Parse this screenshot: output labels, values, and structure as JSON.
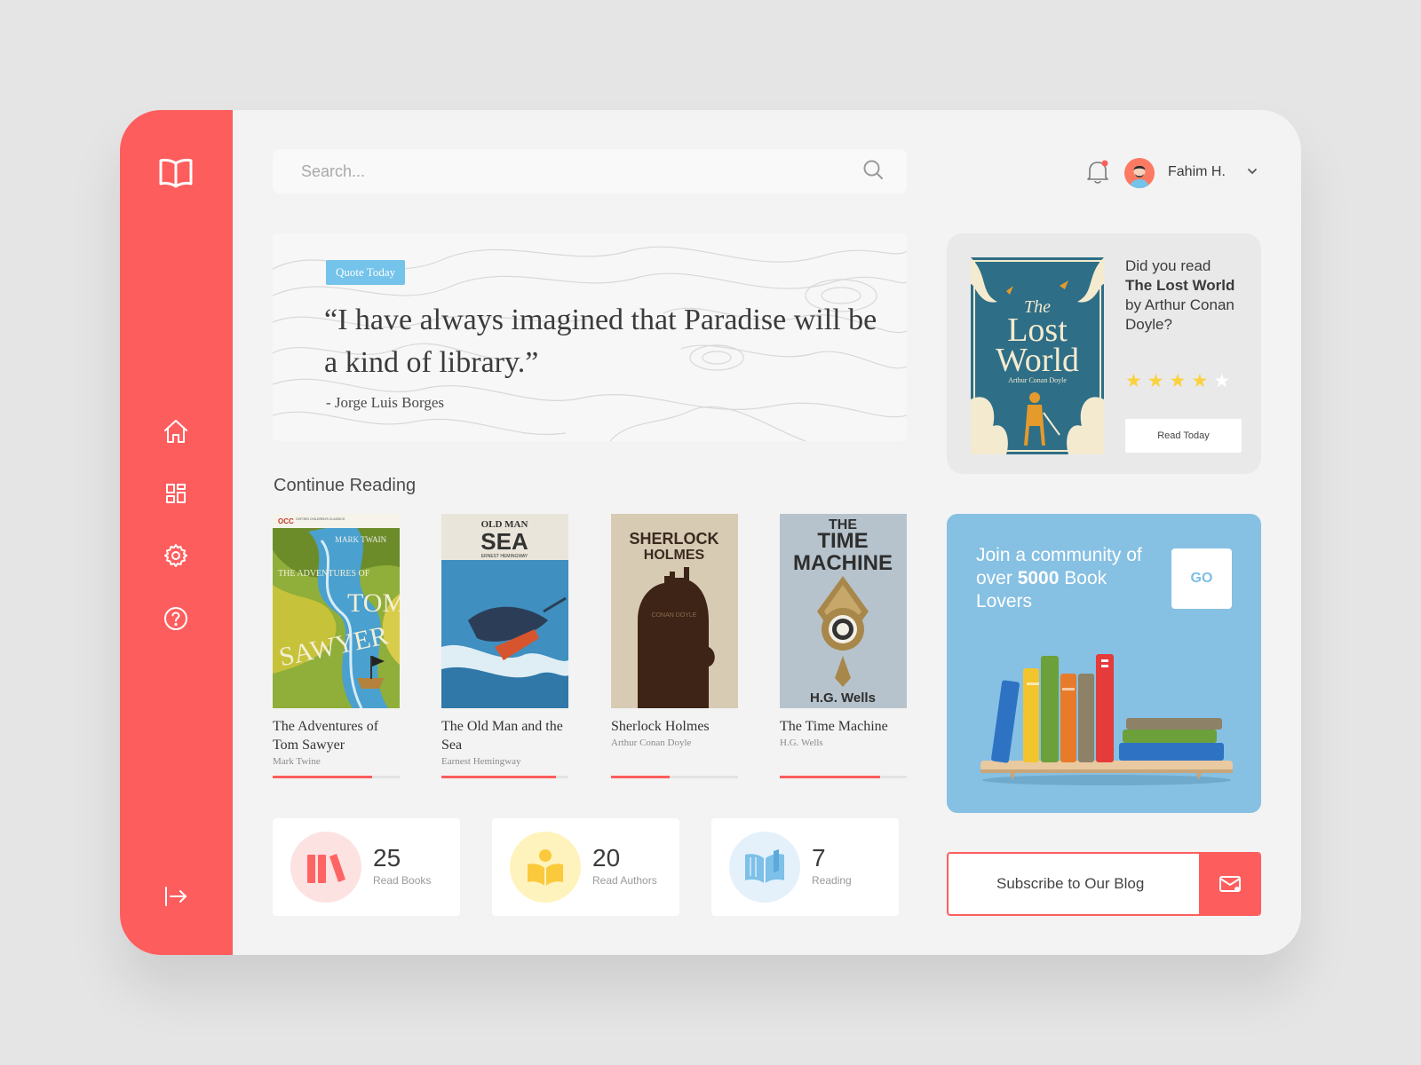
{
  "colors": {
    "accent": "#fe5d5d",
    "background": "#e6e5e6",
    "panel": "#f3f3f3",
    "tag_blue": "#74c3ea",
    "community_blue": "#86c0e3",
    "star_yellow": "#fbd23e"
  },
  "sidebar": {
    "logo_icon": "open-book-icon",
    "items": [
      {
        "name": "home",
        "icon": "home-icon"
      },
      {
        "name": "dashboard",
        "icon": "grid-icon"
      },
      {
        "name": "settings",
        "icon": "gear-icon"
      },
      {
        "name": "help",
        "icon": "question-icon"
      }
    ],
    "logout_icon": "logout-icon"
  },
  "header": {
    "search_placeholder": "Search...",
    "user_name": "Fahim H."
  },
  "quote": {
    "tag": "Quote Today",
    "text": "“I have always imagined that Paradise will be a kind of library.”",
    "author": "- Jorge Luis Borges"
  },
  "continue_reading": {
    "title": "Continue Reading",
    "books": [
      {
        "title": "The Adventures of Tom Sawyer",
        "author": "Mark Twine",
        "progress": 0.78
      },
      {
        "title": "The Old Man and the Sea",
        "author": "Earnest Hemingway",
        "progress": 0.9
      },
      {
        "title": "Sherlock Holmes",
        "author": "Arthur Conan Doyle",
        "progress": 0.46
      },
      {
        "title": "The Time Machine",
        "author": "H.G. Wells",
        "progress": 0.79
      }
    ]
  },
  "covers": {
    "tom_sawyer": {
      "publisher": "OCC",
      "series": "OXFORD CHILDREN'S CLASSICS",
      "author": "MARK TWAIN",
      "title_line1": "THE ADVENTURES OF",
      "title_line2": "TOM",
      "title_line3": "SAWYER"
    },
    "old_man": {
      "line1": "OLD MAN",
      "line2": "SEA",
      "author": "ERNEST HEMINGWAY"
    },
    "sherlock": {
      "line1": "SHERLOCK",
      "line2": "HOLMES",
      "author": "CONAN DOYLE"
    },
    "time_machine": {
      "line1": "THE",
      "line2": "TIME",
      "line3": "MACHINE",
      "author": "H.G. Wells"
    },
    "lost_world": {
      "line1": "The",
      "line2": "Lost",
      "line3": "World",
      "author": "Arthur Conan Doyle"
    }
  },
  "stats": [
    {
      "value": "25",
      "label": "Read Books",
      "icon": "books-icon"
    },
    {
      "value": "20",
      "label": "Read Authors",
      "icon": "reader-icon"
    },
    {
      "value": "7",
      "label": "Reading",
      "icon": "open-book-icon"
    }
  ],
  "suggestion": {
    "prefix": "Did you read",
    "book": "The Lost World",
    "suffix": "by Arthur Conan Doyle?",
    "rating": 4,
    "rating_max": 5,
    "button": "Read Today"
  },
  "community": {
    "prefix": "Join a community of over",
    "count": "5000",
    "suffix": "Book Lovers",
    "button": "GO"
  },
  "subscribe": {
    "label": "Subscribe to Our Blog",
    "icon": "mail-icon"
  }
}
